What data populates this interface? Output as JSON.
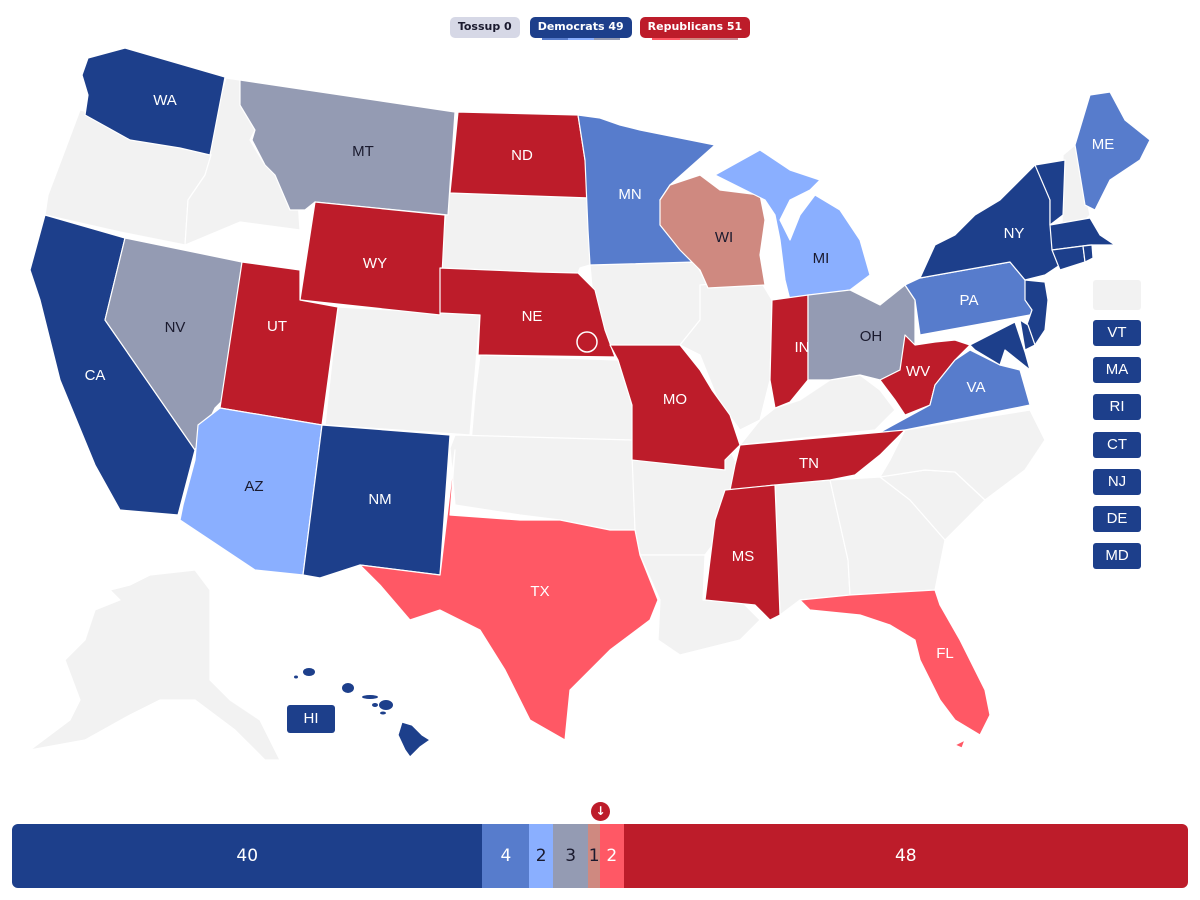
{
  "legend": {
    "tossup": {
      "label": "Tossup 0"
    },
    "democrats": {
      "label": "Democrats 49"
    },
    "republicans": {
      "label": "Republicans 51"
    }
  },
  "colors": {
    "safe_d": "#1d3f8b",
    "likely_d": "#577ccc",
    "lean_d": "#8aafff",
    "tossup": "#949bb3",
    "lean_r": "#cf8980",
    "likely_r": "#ff5865",
    "safe_r": "#bd1c2a",
    "no_race": "#f2f2f2"
  },
  "ratings": {
    "WA": "safe_d",
    "CA": "safe_d",
    "NM": "safe_d",
    "NY": "safe_d",
    "HI": "safe_d",
    "VT": "safe_d",
    "MA": "safe_d",
    "RI": "safe_d",
    "CT": "safe_d",
    "NJ": "safe_d",
    "DE": "safe_d",
    "MD": "safe_d",
    "MN": "likely_d",
    "ME": "likely_d",
    "PA": "likely_d",
    "VA": "likely_d",
    "AZ": "lean_d",
    "MI": "lean_d",
    "MT": "tossup",
    "NV": "tossup",
    "OH": "tossup",
    "WI": "lean_r",
    "TX": "likely_r",
    "FL": "likely_r",
    "ND": "safe_r",
    "WY": "safe_r",
    "UT": "safe_r",
    "NE": "safe_r",
    "MO": "safe_r",
    "IN": "safe_r",
    "WV": "safe_r",
    "TN": "safe_r",
    "MS": "safe_r"
  },
  "map_labels": {
    "WA": "WA",
    "MT": "MT",
    "ND": "ND",
    "MN": "MN",
    "ME": "ME",
    "WI": "WI",
    "MI": "MI",
    "NY": "NY",
    "WY": "WY",
    "NV": "NV",
    "UT": "UT",
    "NE": "NE",
    "CA": "CA",
    "PA": "PA",
    "OH": "OH",
    "IN": "IN",
    "WV": "WV",
    "VA": "VA",
    "MO": "MO",
    "AZ": "AZ",
    "NM": "NM",
    "TN": "TN",
    "TX": "TX",
    "MS": "MS",
    "FL": "FL"
  },
  "small_states": [
    "VT",
    "MA",
    "RI",
    "CT",
    "NJ",
    "DE",
    "MD"
  ],
  "hawaii_label": "HI",
  "seat_bar": {
    "segments": [
      {
        "rating": "safe_d",
        "seats": 40,
        "label": "40"
      },
      {
        "rating": "likely_d",
        "seats": 4,
        "label": "4"
      },
      {
        "rating": "lean_d",
        "seats": 2,
        "label": "2"
      },
      {
        "rating": "tossup",
        "seats": 3,
        "label": "3"
      },
      {
        "rating": "lean_r",
        "seats": 1,
        "label": "1"
      },
      {
        "rating": "likely_r",
        "seats": 2,
        "label": "2"
      },
      {
        "rating": "safe_r",
        "seats": 48,
        "label": "48"
      }
    ],
    "total_seats": 100,
    "majority_marker_icon": "arrow-down-icon",
    "majority_marker_glyph": "↓"
  }
}
